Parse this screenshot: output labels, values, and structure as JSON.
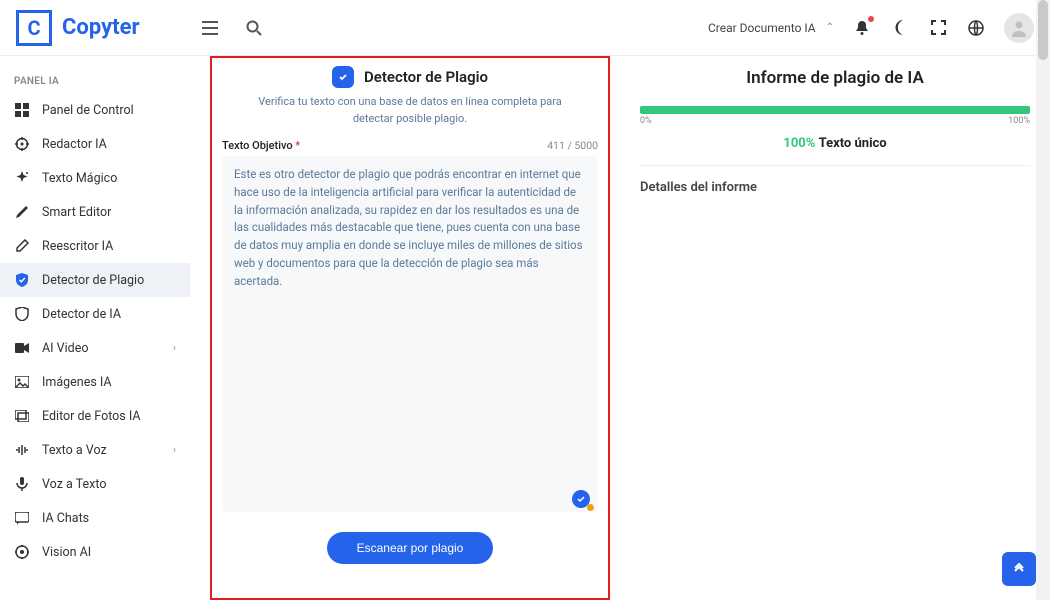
{
  "brand": {
    "letter": "C",
    "name": "Copyter"
  },
  "header": {
    "create_doc": "Crear Documento IA"
  },
  "sidebar": {
    "heading": "PANEL IA",
    "items": [
      {
        "label": "Panel de Control",
        "icon": "dashboard"
      },
      {
        "label": "Redactor IA",
        "icon": "ai"
      },
      {
        "label": "Texto Mágico",
        "icon": "sparkle"
      },
      {
        "label": "Smart Editor",
        "icon": "pen"
      },
      {
        "label": "Reescritor IA",
        "icon": "edit"
      },
      {
        "label": "Detector de Plagio",
        "icon": "shield",
        "active": true
      },
      {
        "label": "Detector de IA",
        "icon": "shield-outline"
      },
      {
        "label": "AI Video",
        "icon": "video",
        "chevron": true
      },
      {
        "label": "Imágenes IA",
        "icon": "image"
      },
      {
        "label": "Editor de Fotos IA",
        "icon": "photo"
      },
      {
        "label": "Texto a Voz",
        "icon": "sound",
        "chevron": true
      },
      {
        "label": "Voz a Texto",
        "icon": "mic"
      },
      {
        "label": "IA Chats",
        "icon": "chat"
      },
      {
        "label": "Vision AI",
        "icon": "vision"
      }
    ]
  },
  "center": {
    "title": "Detector de Plagio",
    "subtitle": "Verifica tu texto con una base de datos en línea completa para detectar posible plagio.",
    "field_label": "Texto Objetivo",
    "counter": "411 / 5000",
    "text_value": "Este es otro detector de plagio que podrás encontrar en internet que hace uso de la inteligencia artificial para verificar la autenticidad de la información analizada, su rapidez en dar los resultados es una de las cualidades más destacable que tiene, pues cuenta con una base de datos muy amplia en donde se incluye miles de millones de sitios web y documentos para que la detección de plagio sea más acertada.",
    "scan_btn": "Escanear por plagio"
  },
  "report": {
    "title": "Informe de plagio de IA",
    "min": "0%",
    "max": "100%",
    "pct": "100%",
    "unique": "Texto único",
    "details": "Detalles del informe"
  }
}
